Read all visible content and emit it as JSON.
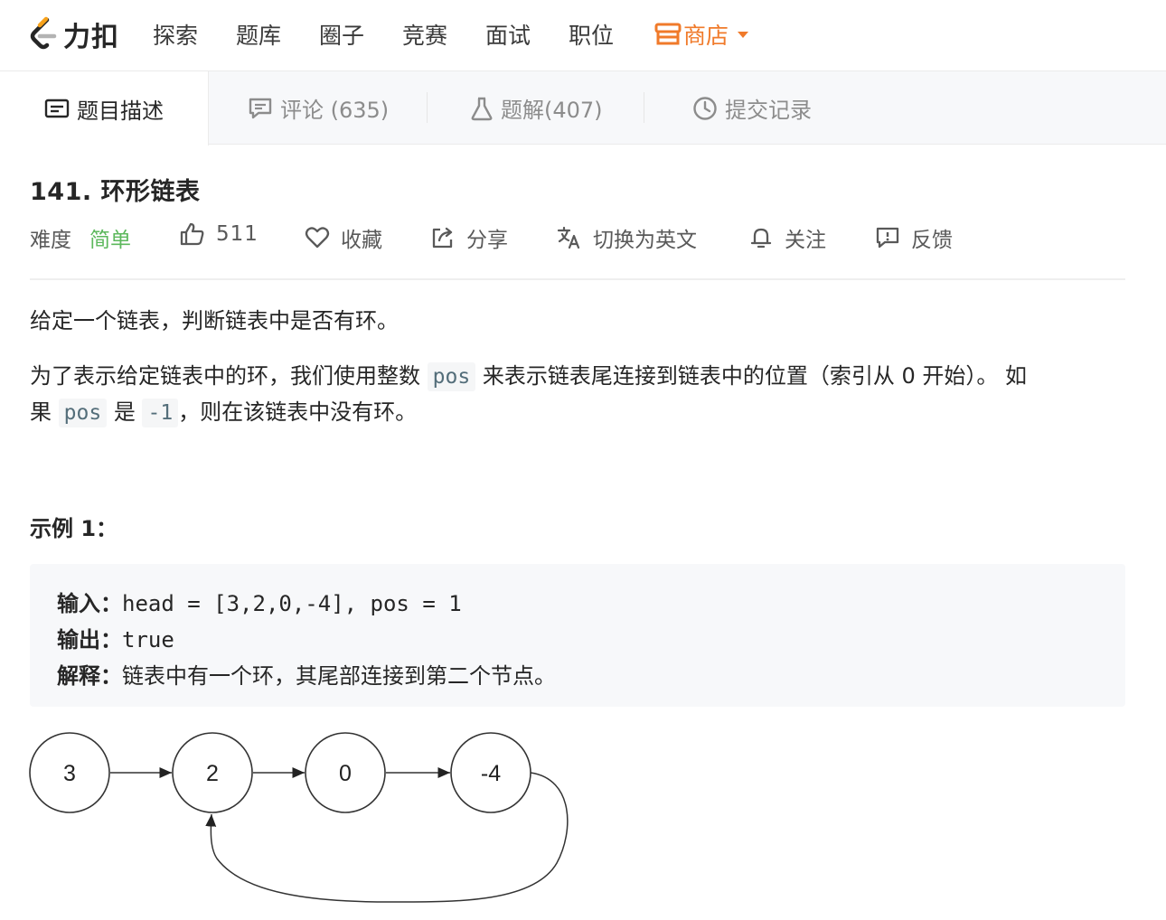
{
  "brand": {
    "name": "力扣"
  },
  "nav": {
    "items": [
      "探索",
      "题库",
      "圈子",
      "竞赛",
      "面试",
      "职位"
    ],
    "store_label": "商店"
  },
  "tabs": {
    "description": "题目描述",
    "comments": "评论 (635)",
    "solutions": "题解(407)",
    "submissions": "提交记录"
  },
  "problem": {
    "title": "141. 环形链表",
    "difficulty_label": "难度",
    "difficulty": "简单",
    "likes": "511",
    "favorite": "收藏",
    "share": "分享",
    "switch_lang": "切换为英文",
    "follow": "关注",
    "feedback": "反馈"
  },
  "content": {
    "p1": "给定一个链表，判断链表中是否有环。",
    "p2_a": "为了表示给定链表中的环，我们使用整数",
    "p2_code1": "pos",
    "p2_b": "来表示链表尾连接到链表中的位置（索引从 0 开始）。 如",
    "p2_c": "果",
    "p2_code2": "pos",
    "p2_d": "是",
    "p2_code3": "-1",
    "p2_e": "，则在该链表中没有环。",
    "example_title": "示例 1：",
    "example": {
      "input_label": "输入：",
      "input_value": "head = [3,2,0,-4], pos = 1",
      "output_label": "输出：",
      "output_value": "true",
      "explain_label": "解释：",
      "explain_value": "链表中有一个环，其尾部连接到第二个节点。"
    }
  },
  "diagram": {
    "nodes": [
      "3",
      "2",
      "0",
      "-4"
    ]
  }
}
